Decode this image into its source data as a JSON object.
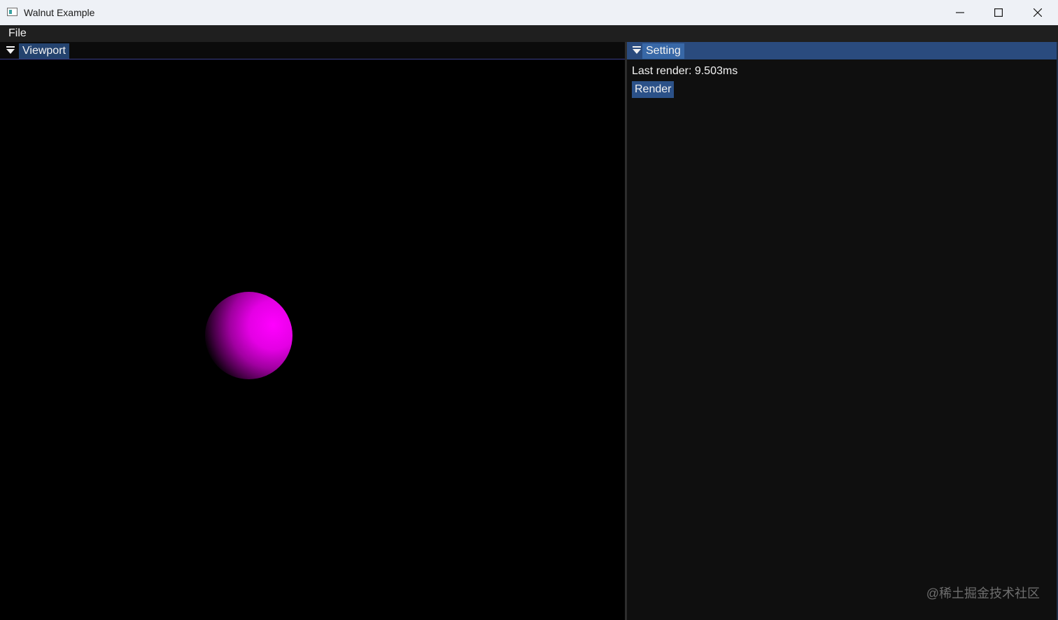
{
  "window": {
    "title": "Walnut Example"
  },
  "menubar": {
    "items": [
      {
        "label": "File"
      }
    ]
  },
  "viewport_panel": {
    "tab_label": "Viewport",
    "collapse_icon": "triangle-down-icon"
  },
  "setting_panel": {
    "tab_label": "Setting",
    "collapse_icon": "triangle-down-icon",
    "last_render": "Last render: 9.503ms",
    "render_button": "Render"
  },
  "watermark": {
    "text": "@稀土掘金技术社区"
  },
  "colors": {
    "accent": "#2a4b7e",
    "tab_active": "#3868a7",
    "button": "#2b5188",
    "sphere": "#ff00ff",
    "background": "#0f0f0f"
  },
  "icons": {
    "app": "app-window-icon",
    "minimize": "minimize-icon",
    "maximize": "maximize-icon",
    "close": "close-icon"
  }
}
